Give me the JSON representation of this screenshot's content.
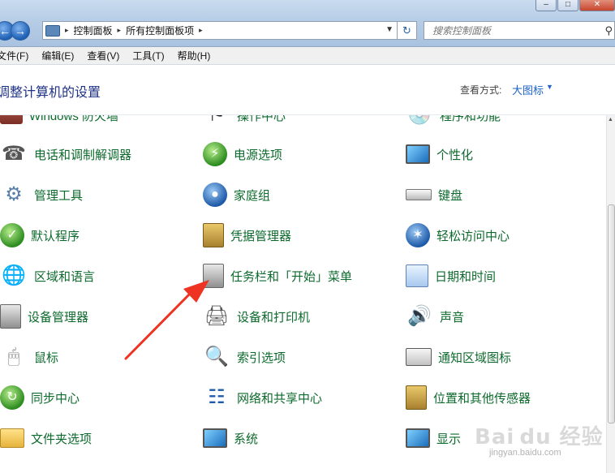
{
  "window": {
    "min_label": "–",
    "max_label": "□",
    "close_label": "✕"
  },
  "nav": {
    "back": "←",
    "forward": "→"
  },
  "address": {
    "crumbs": [
      "控制面板",
      "所有控制面板项"
    ],
    "sep": "▸",
    "dropdown": "▼",
    "refresh": "↻"
  },
  "search": {
    "placeholder": "搜索控制面板",
    "icon": "magnifier-icon"
  },
  "menu": [
    "文件(F)",
    "编辑(E)",
    "查看(V)",
    "工具(T)",
    "帮助(H)"
  ],
  "header": {
    "title": "调整计算机的设置",
    "view_by_label": "查看方式:",
    "view_by_value": "大图标",
    "view_by_arrow": "▼"
  },
  "items": [
    {
      "label": "Windows 防火墙",
      "icon": "firewall-icon"
    },
    {
      "label": "操作中心",
      "icon": "action-center-icon"
    },
    {
      "label": "程序和功能",
      "icon": "programs-icon"
    },
    {
      "label": "电话和调制解调器",
      "icon": "phone-modem-icon"
    },
    {
      "label": "电源选项",
      "icon": "power-options-icon"
    },
    {
      "label": "个性化",
      "icon": "personalization-icon"
    },
    {
      "label": "管理工具",
      "icon": "admin-tools-icon"
    },
    {
      "label": "家庭组",
      "icon": "homegroup-icon"
    },
    {
      "label": "键盘",
      "icon": "keyboard-icon"
    },
    {
      "label": "默认程序",
      "icon": "default-programs-icon"
    },
    {
      "label": "凭据管理器",
      "icon": "credential-manager-icon"
    },
    {
      "label": "轻松访问中心",
      "icon": "ease-of-access-icon"
    },
    {
      "label": "区域和语言",
      "icon": "region-language-icon"
    },
    {
      "label": "任务栏和「开始」菜单",
      "icon": "taskbar-start-icon"
    },
    {
      "label": "日期和时间",
      "icon": "date-time-icon"
    },
    {
      "label": "设备管理器",
      "icon": "device-manager-icon"
    },
    {
      "label": "设备和打印机",
      "icon": "devices-printers-icon"
    },
    {
      "label": "声音",
      "icon": "sound-icon"
    },
    {
      "label": "鼠标",
      "icon": "mouse-icon"
    },
    {
      "label": "索引选项",
      "icon": "indexing-options-icon"
    },
    {
      "label": "通知区域图标",
      "icon": "notification-area-icon"
    },
    {
      "label": "同步中心",
      "icon": "sync-center-icon"
    },
    {
      "label": "网络和共享中心",
      "icon": "network-sharing-icon"
    },
    {
      "label": "位置和其他传感器",
      "icon": "location-sensors-icon"
    },
    {
      "label": "文件夹选项",
      "icon": "folder-options-icon"
    },
    {
      "label": "系统",
      "icon": "system-icon"
    },
    {
      "label": "显示",
      "icon": "display-icon"
    }
  ],
  "watermark": {
    "logo": "Bai du 经验",
    "url": "jingyan.baidu.com"
  },
  "colors": {
    "item_text": "#0d6a2d",
    "title_text": "#1e3287",
    "link_blue": "#1e63c9",
    "annotation_red": "#ee3322"
  }
}
